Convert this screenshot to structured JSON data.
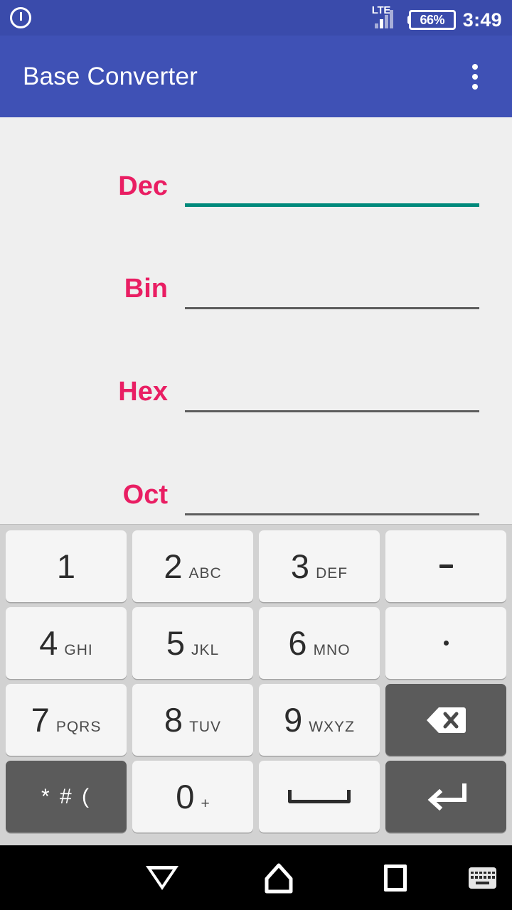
{
  "status_bar": {
    "power_icon": "power-icon",
    "network_label": "LTE",
    "signal_icon": "signal-bars-icon",
    "battery_text": "66%",
    "battery_icon": "battery-icon",
    "clock": "3:49",
    "bg_color": "#3a4bab"
  },
  "app_bar": {
    "title": "Base Converter",
    "overflow_icon": "more-vert-icon",
    "bg_color": "#3f51b5"
  },
  "form": {
    "accent_label_color": "#e91e63",
    "focused_underline_color": "#00897b",
    "idle_underline_color": "#5d5d5d",
    "fields": [
      {
        "label": "Dec",
        "value": "",
        "placeholder": "",
        "focused": true
      },
      {
        "label": "Bin",
        "value": "",
        "placeholder": "",
        "focused": false
      },
      {
        "label": "Hex",
        "value": "",
        "placeholder": "",
        "focused": false
      },
      {
        "label": "Oct",
        "value": "",
        "placeholder": "",
        "focused": false
      }
    ]
  },
  "keyboard": {
    "bg_color": "#d2d2d2",
    "key_color": "#f5f5f5",
    "dark_key_color": "#5b5b5b",
    "rows": [
      [
        {
          "name": "key-1",
          "digit": "1",
          "letters": ""
        },
        {
          "name": "key-2",
          "digit": "2",
          "letters": "ABC"
        },
        {
          "name": "key-3",
          "digit": "3",
          "letters": "DEF"
        },
        {
          "name": "key-dash",
          "digit": "-",
          "letters": "",
          "glyph": "dash"
        }
      ],
      [
        {
          "name": "key-4",
          "digit": "4",
          "letters": "GHI"
        },
        {
          "name": "key-5",
          "digit": "5",
          "letters": "JKL"
        },
        {
          "name": "key-6",
          "digit": "6",
          "letters": "MNO"
        },
        {
          "name": "key-period",
          "digit": ".",
          "letters": "",
          "glyph": "dot"
        }
      ],
      [
        {
          "name": "key-7",
          "digit": "7",
          "letters": "PQRS"
        },
        {
          "name": "key-8",
          "digit": "8",
          "letters": "TUV"
        },
        {
          "name": "key-9",
          "digit": "9",
          "letters": "WXYZ"
        },
        {
          "name": "key-backspace",
          "digit": "",
          "letters": "",
          "glyph": "backspace",
          "dark": true
        }
      ],
      [
        {
          "name": "key-symbols",
          "digit": "* # (",
          "letters": "",
          "glyph": "symbols",
          "dark": true
        },
        {
          "name": "key-0",
          "digit": "0",
          "letters": "+",
          "sub": true
        },
        {
          "name": "key-space",
          "digit": "",
          "letters": "",
          "glyph": "space"
        },
        {
          "name": "key-enter",
          "digit": "",
          "letters": "",
          "glyph": "enter",
          "dark": true
        }
      ]
    ]
  },
  "nav_bar": {
    "back_icon": "back-triangle-icon",
    "home_icon": "home-icon",
    "recents_icon": "recents-square-icon",
    "keyboard_toggle_icon": "keyboard-icon",
    "bg_color": "#000000"
  }
}
